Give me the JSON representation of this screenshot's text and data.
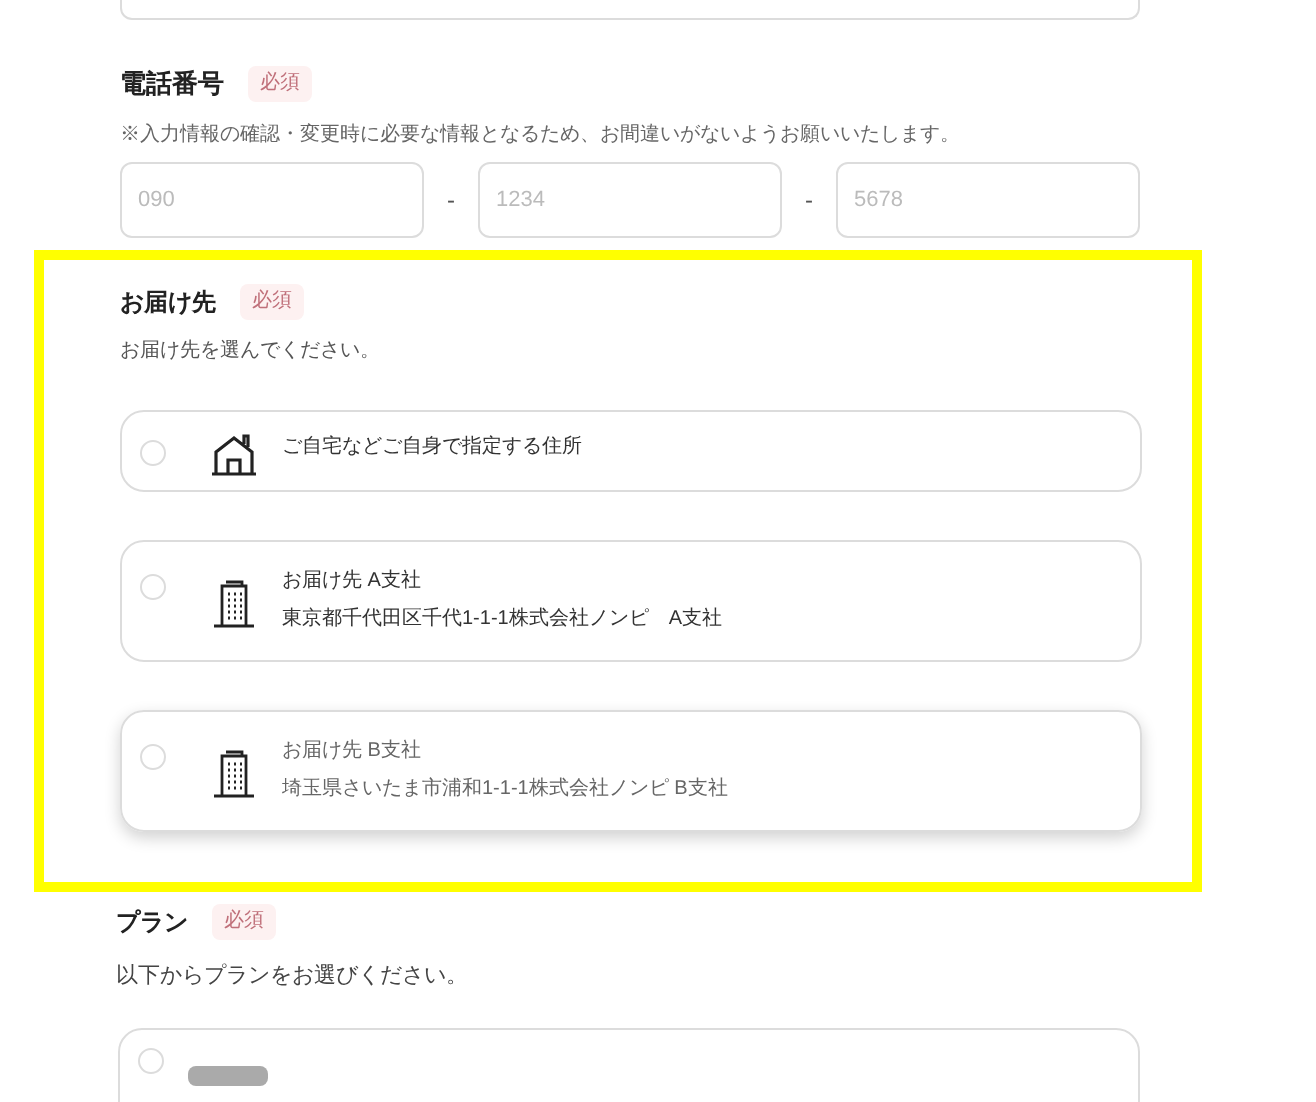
{
  "phone": {
    "label": "電話番号",
    "badge": "必須",
    "note": "※入力情報の確認・変更時に必要な情報となるため、お間違いがないようお願いいたします。",
    "fields": [
      {
        "placeholder": "090"
      },
      {
        "placeholder": "1234"
      },
      {
        "placeholder": "5678"
      }
    ],
    "separators": [
      "-",
      "-"
    ]
  },
  "destination": {
    "label": "お届け先",
    "badge": "必須",
    "hint": "お届け先を選んでください。",
    "options": [
      {
        "kind": "home",
        "selected": false,
        "hovered": false,
        "lines": [
          "ご自宅などご自身で指定する住所"
        ]
      },
      {
        "kind": "office",
        "selected": false,
        "hovered": false,
        "lines": [
          "お届け先 A支社",
          "東京都千代田区千代1-1-1株式会社ノンピ　A支社"
        ]
      },
      {
        "kind": "office",
        "selected": false,
        "hovered": true,
        "lines": [
          "お届け先 B支社",
          "埼玉県さいたま市浦和1-1-1株式会社ノンピ B支社"
        ]
      }
    ]
  },
  "plan": {
    "label": "プラン",
    "badge": "必須",
    "hint": "以下からプランをお選びください。",
    "options": [
      {
        "selected": false
      }
    ]
  }
}
